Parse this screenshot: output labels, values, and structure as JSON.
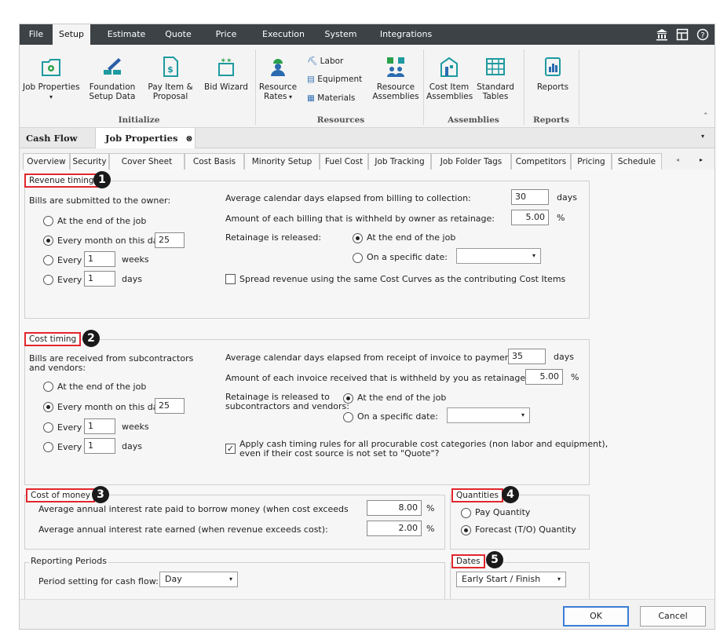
{
  "menubar": {
    "tabs": [
      "File",
      "Setup",
      "Estimate",
      "Quote",
      "Price",
      "Execution",
      "System",
      "Integrations"
    ],
    "active": "Setup"
  },
  "ribbon": {
    "job_properties": "Job Properties",
    "foundation": "Foundation\nSetup Data",
    "pay_item": "Pay Item &\nProposal",
    "bid_wizard": "Bid Wizard",
    "resource_rates": "Resource\nRates",
    "labor": "Labor",
    "equipment": "Equipment",
    "materials": "Materials",
    "resource_assemblies": "Resource\nAssemblies",
    "cost_item_assemblies": "Cost Item\nAssemblies",
    "standard_tables": "Standard\nTables",
    "reports": "Reports",
    "groups": {
      "initialize": "Initialize",
      "resources": "Resources",
      "assemblies": "Assemblies",
      "reports": "Reports"
    }
  },
  "doctabs": {
    "cash_flow": "Cash Flow",
    "job_properties": "Job Properties"
  },
  "subtabs": [
    "Overview",
    "Security",
    "Cover Sheet",
    "Cost Basis",
    "Minority Setup",
    "Fuel Cost",
    "Job Tracking",
    "Job Folder Tags",
    "Competitors",
    "Pricing",
    "Schedule"
  ],
  "revenue": {
    "title": "Revenue timing",
    "badge": "1",
    "bills_label": "Bills are submitted to the owner:",
    "opt_end": "At the end of the job",
    "opt_month": "Every month on this day",
    "month_day": "25",
    "opt_weeks": "Every",
    "weeks_val": "1",
    "weeks_unit": "weeks",
    "opt_days": "Every",
    "days_val": "1",
    "days_unit": "days",
    "avg_days_label": "Average calendar days elapsed from billing to collection:",
    "avg_days_val": "30",
    "avg_days_unit": "days",
    "withheld_label": "Amount of each billing that is withheld by owner as retainage:",
    "withheld_val": "5.00",
    "withheld_unit": "%",
    "released_label": "Retainage is released:",
    "rel_end": "At the end of the job",
    "rel_date": "On a specific date:",
    "spread_label": "Spread revenue using the same Cost Curves as the contributing Cost Items"
  },
  "cost": {
    "title": "Cost timing",
    "badge": "2",
    "bills_label_1": "Bills are received from subcontractors",
    "bills_label_2": "and vendors:",
    "opt_end": "At the end of the job",
    "opt_month": "Every month on this day",
    "month_day": "25",
    "opt_weeks": "Every",
    "weeks_val": "1",
    "weeks_unit": "weeks",
    "opt_days": "Every",
    "days_val": "1",
    "days_unit": "days",
    "avg_days_label": "Average calendar days elapsed from receipt of invoice to payment:",
    "avg_days_val": "35",
    "avg_days_unit": "days",
    "withheld_label": "Amount of each invoice received that is withheld by you as retainage:",
    "withheld_val": "5.00",
    "withheld_unit": "%",
    "released_label_1": "Retainage is released to",
    "released_label_2": "subcontractors and vendors:",
    "rel_end": "At the end of the job",
    "rel_date": "On a specific date:",
    "apply_label_1": "Apply cash timing rules for all procurable cost categories (non labor and equipment),",
    "apply_label_2": "even if their cost source is not set to \"Quote\"?"
  },
  "money": {
    "title": "Cost of money",
    "badge": "3",
    "borrow_label": "Average annual interest rate paid to borrow money (when cost exceeds",
    "borrow_val": "8.00",
    "earn_label": "Average annual interest rate earned (when revenue exceeds cost):",
    "earn_val": "2.00",
    "unit": "%"
  },
  "quantities": {
    "title": "Quantities",
    "badge": "4",
    "pay": "Pay Quantity",
    "forecast": "Forecast (T/O) Quantity"
  },
  "reporting": {
    "title": "Reporting Periods",
    "period_label": "Period setting for cash flow:",
    "period_val": "Day"
  },
  "dates": {
    "title": "Dates",
    "badge": "5",
    "val": "Early Start / Finish"
  },
  "footer": {
    "ok": "OK",
    "cancel": "Cancel"
  }
}
